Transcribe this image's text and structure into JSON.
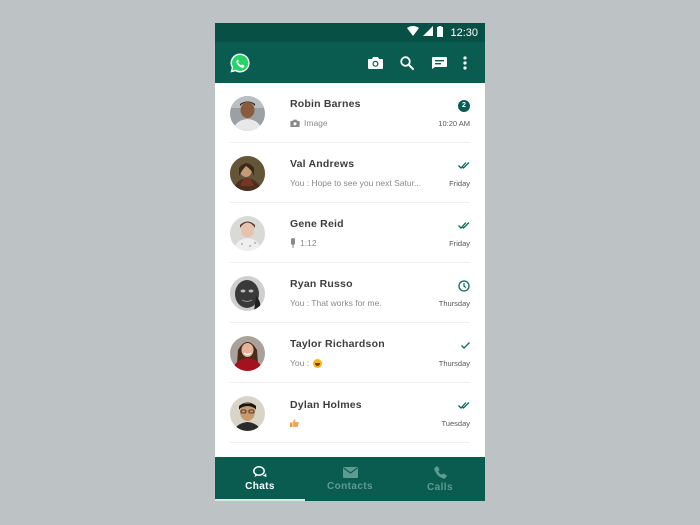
{
  "colors": {
    "primary": "#0a5c50",
    "primary_dark": "#075045",
    "accent": "#25d366",
    "tick": "#0a6b5e"
  },
  "status_bar": {
    "time": "12:30",
    "icons": [
      "wifi-icon",
      "signal-icon",
      "battery-icon"
    ]
  },
  "app_bar": {
    "logo": "whatsapp-logo",
    "actions": [
      {
        "name": "camera-icon",
        "label": "Camera"
      },
      {
        "name": "search-icon",
        "label": "Search"
      },
      {
        "name": "new-chat-icon",
        "label": "New chat"
      },
      {
        "name": "more-icon",
        "label": "More options"
      }
    ]
  },
  "chats": [
    {
      "name": "Robin Barnes",
      "preview_icon": "camera-icon",
      "preview": "Image",
      "time": "10:20 AM",
      "status": "badge",
      "unread": "2"
    },
    {
      "name": "Val Andrews",
      "preview_icon": "",
      "preview": "You : Hope to see you next Satur...",
      "time": "Friday",
      "status": "double-check"
    },
    {
      "name": "Gene Reid",
      "preview_icon": "mic-icon",
      "preview": "1:12",
      "time": "Friday",
      "status": "double-check"
    },
    {
      "name": "Ryan Russo",
      "preview_icon": "",
      "preview": "You : That works for me.",
      "time": "Thursday",
      "status": "clock"
    },
    {
      "name": "Taylor Richardson",
      "preview_icon": "",
      "preview": "You :",
      "preview_emoji": "😆",
      "time": "Thursday",
      "status": "check"
    },
    {
      "name": "Dylan Holmes",
      "preview_icon": "",
      "preview": "",
      "preview_emoji": "👍",
      "time": "Tuesday",
      "status": "double-check"
    }
  ],
  "tabs": [
    {
      "label": "Chats",
      "icon": "chat-bubbles-icon",
      "active": true
    },
    {
      "label": "Contacts",
      "icon": "envelope-icon",
      "active": false
    },
    {
      "label": "Calls",
      "icon": "phone-icon",
      "active": false
    }
  ]
}
